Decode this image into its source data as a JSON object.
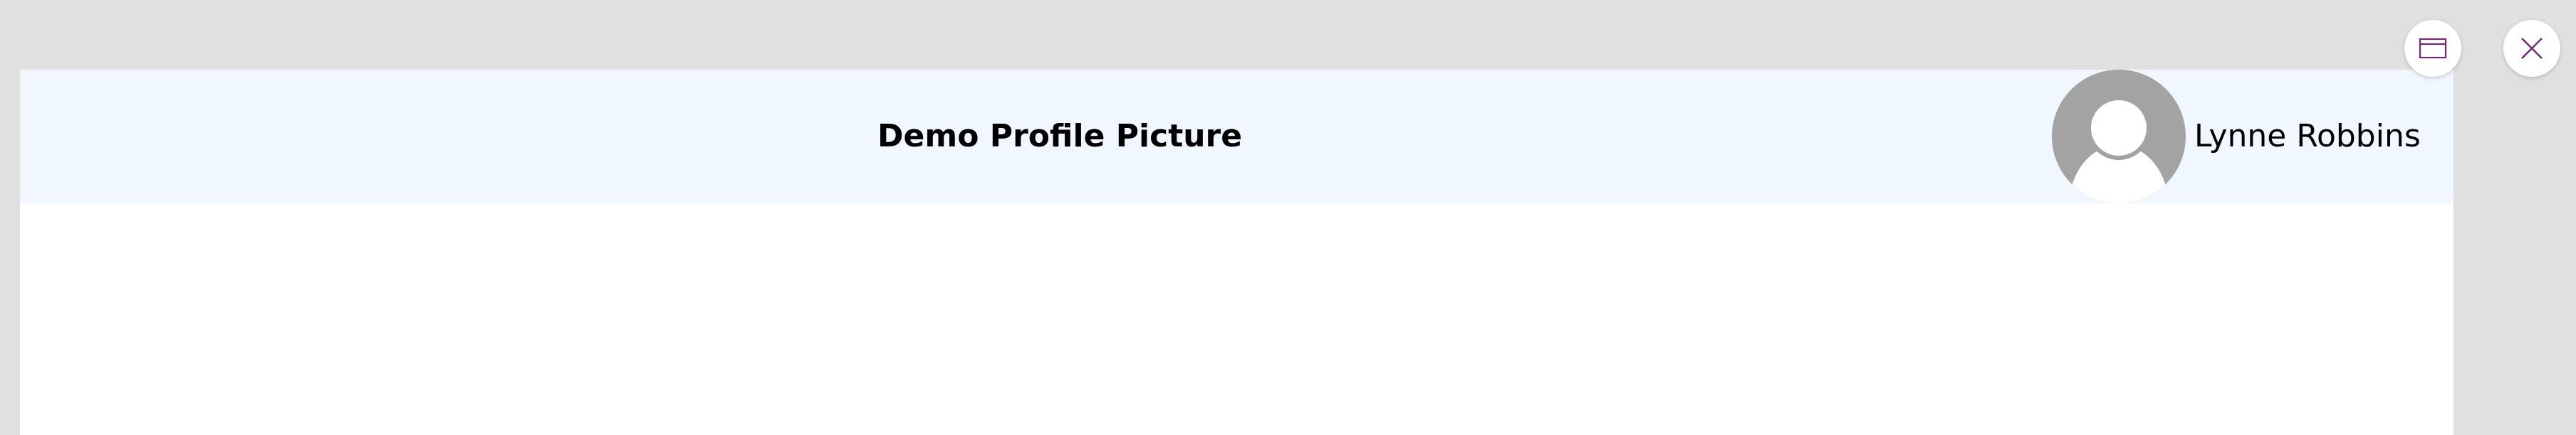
{
  "header": {
    "title": "Demo Profile Picture",
    "user_name": "Lynne Robbins"
  },
  "icons": {
    "avatar": "person-placeholder-icon",
    "window": "window-icon",
    "close": "close-icon"
  },
  "colors": {
    "page_background": "#e0e0e0",
    "header_background": "#f1f7fe",
    "avatar_background": "#a3a3a3",
    "accent": "#742774"
  }
}
